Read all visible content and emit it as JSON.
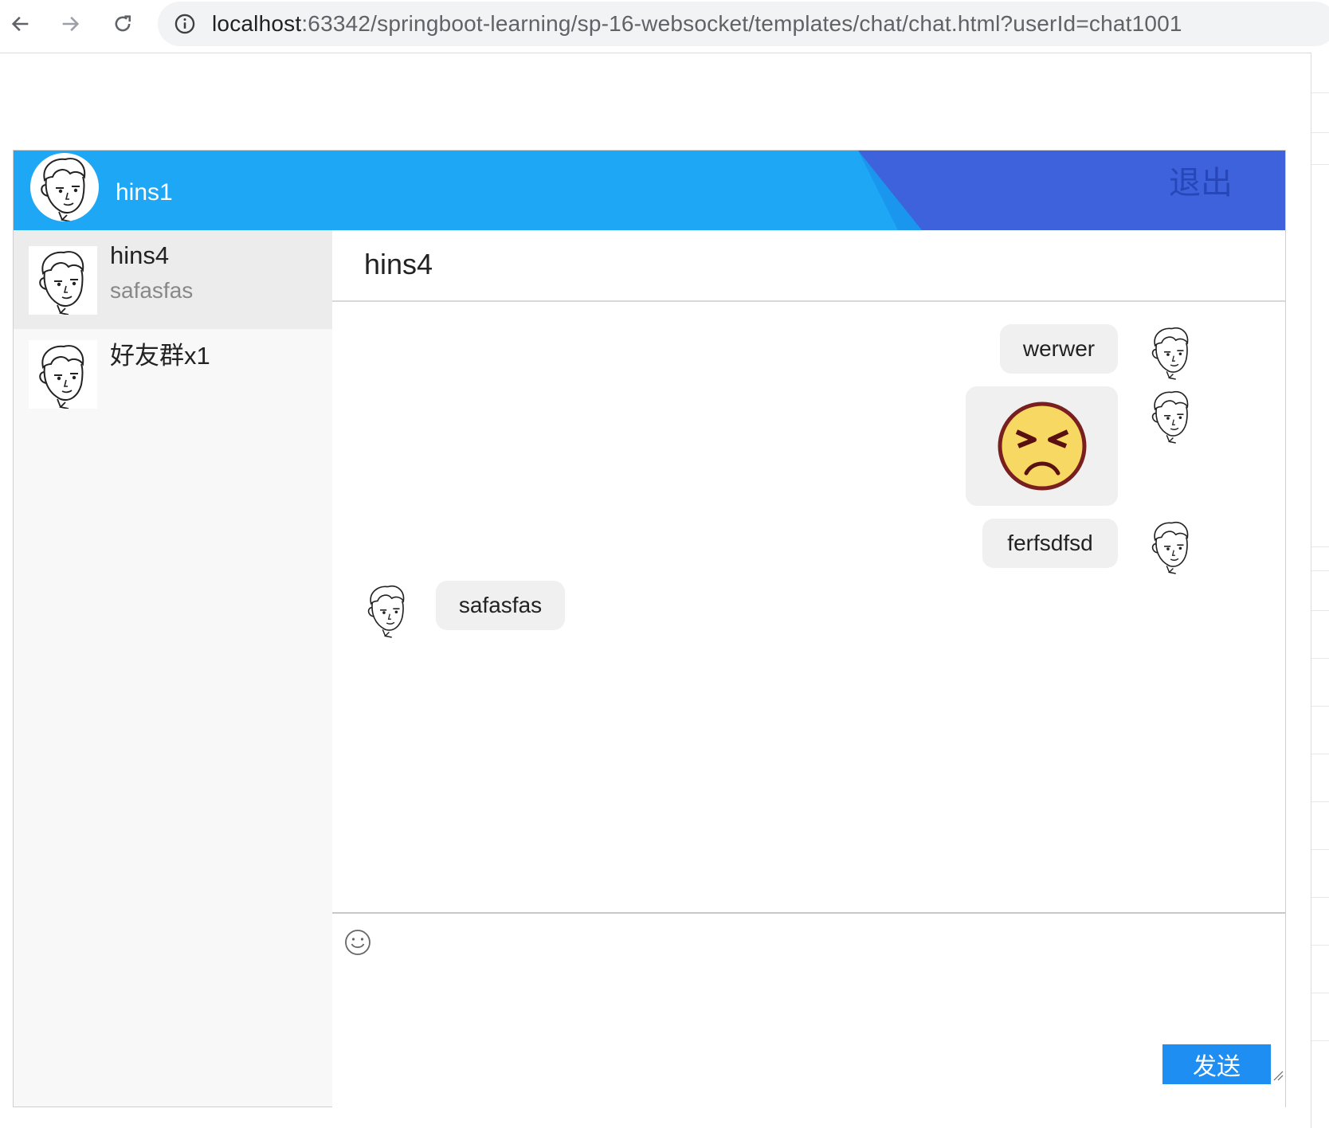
{
  "browser": {
    "url_host": "localhost",
    "url_rest": ":63342/springboot-learning/sp-16-websocket/templates/chat/chat.html?userId=chat1001"
  },
  "header": {
    "username": "hins1",
    "logout_label": "退出",
    "colors": {
      "primary": "#1ea7f5",
      "accent": "#3d62dc"
    }
  },
  "sidebar": {
    "contacts": [
      {
        "name": "hins4",
        "last_message": "safasfas",
        "active": true
      },
      {
        "name": "好友群x1",
        "last_message": "",
        "active": false
      }
    ]
  },
  "conversation": {
    "title": "hins4",
    "messages": [
      {
        "from": "self",
        "type": "text",
        "text": "werwer"
      },
      {
        "from": "self",
        "type": "emoji",
        "emoji": "angry-face-emoji"
      },
      {
        "from": "self",
        "type": "text",
        "text": "ferfsdfsd"
      },
      {
        "from": "other",
        "type": "text",
        "text": "safasfas"
      }
    ]
  },
  "composer": {
    "send_label": "发送",
    "send_color": "#1e8ef3"
  }
}
